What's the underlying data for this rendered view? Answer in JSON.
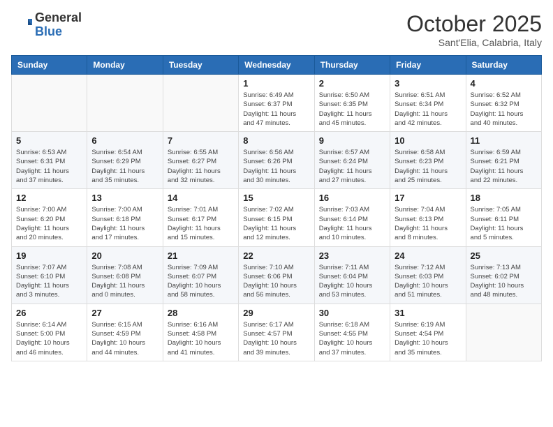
{
  "header": {
    "logo_general": "General",
    "logo_blue": "Blue",
    "month_title": "October 2025",
    "subtitle": "Sant'Elia, Calabria, Italy"
  },
  "days_of_week": [
    "Sunday",
    "Monday",
    "Tuesday",
    "Wednesday",
    "Thursday",
    "Friday",
    "Saturday"
  ],
  "weeks": [
    [
      {
        "day": "",
        "info": ""
      },
      {
        "day": "",
        "info": ""
      },
      {
        "day": "",
        "info": ""
      },
      {
        "day": "1",
        "info": "Sunrise: 6:49 AM\nSunset: 6:37 PM\nDaylight: 11 hours\nand 47 minutes."
      },
      {
        "day": "2",
        "info": "Sunrise: 6:50 AM\nSunset: 6:35 PM\nDaylight: 11 hours\nand 45 minutes."
      },
      {
        "day": "3",
        "info": "Sunrise: 6:51 AM\nSunset: 6:34 PM\nDaylight: 11 hours\nand 42 minutes."
      },
      {
        "day": "4",
        "info": "Sunrise: 6:52 AM\nSunset: 6:32 PM\nDaylight: 11 hours\nand 40 minutes."
      }
    ],
    [
      {
        "day": "5",
        "info": "Sunrise: 6:53 AM\nSunset: 6:31 PM\nDaylight: 11 hours\nand 37 minutes."
      },
      {
        "day": "6",
        "info": "Sunrise: 6:54 AM\nSunset: 6:29 PM\nDaylight: 11 hours\nand 35 minutes."
      },
      {
        "day": "7",
        "info": "Sunrise: 6:55 AM\nSunset: 6:27 PM\nDaylight: 11 hours\nand 32 minutes."
      },
      {
        "day": "8",
        "info": "Sunrise: 6:56 AM\nSunset: 6:26 PM\nDaylight: 11 hours\nand 30 minutes."
      },
      {
        "day": "9",
        "info": "Sunrise: 6:57 AM\nSunset: 6:24 PM\nDaylight: 11 hours\nand 27 minutes."
      },
      {
        "day": "10",
        "info": "Sunrise: 6:58 AM\nSunset: 6:23 PM\nDaylight: 11 hours\nand 25 minutes."
      },
      {
        "day": "11",
        "info": "Sunrise: 6:59 AM\nSunset: 6:21 PM\nDaylight: 11 hours\nand 22 minutes."
      }
    ],
    [
      {
        "day": "12",
        "info": "Sunrise: 7:00 AM\nSunset: 6:20 PM\nDaylight: 11 hours\nand 20 minutes."
      },
      {
        "day": "13",
        "info": "Sunrise: 7:00 AM\nSunset: 6:18 PM\nDaylight: 11 hours\nand 17 minutes."
      },
      {
        "day": "14",
        "info": "Sunrise: 7:01 AM\nSunset: 6:17 PM\nDaylight: 11 hours\nand 15 minutes."
      },
      {
        "day": "15",
        "info": "Sunrise: 7:02 AM\nSunset: 6:15 PM\nDaylight: 11 hours\nand 12 minutes."
      },
      {
        "day": "16",
        "info": "Sunrise: 7:03 AM\nSunset: 6:14 PM\nDaylight: 11 hours\nand 10 minutes."
      },
      {
        "day": "17",
        "info": "Sunrise: 7:04 AM\nSunset: 6:13 PM\nDaylight: 11 hours\nand 8 minutes."
      },
      {
        "day": "18",
        "info": "Sunrise: 7:05 AM\nSunset: 6:11 PM\nDaylight: 11 hours\nand 5 minutes."
      }
    ],
    [
      {
        "day": "19",
        "info": "Sunrise: 7:07 AM\nSunset: 6:10 PM\nDaylight: 11 hours\nand 3 minutes."
      },
      {
        "day": "20",
        "info": "Sunrise: 7:08 AM\nSunset: 6:08 PM\nDaylight: 11 hours\nand 0 minutes."
      },
      {
        "day": "21",
        "info": "Sunrise: 7:09 AM\nSunset: 6:07 PM\nDaylight: 10 hours\nand 58 minutes."
      },
      {
        "day": "22",
        "info": "Sunrise: 7:10 AM\nSunset: 6:06 PM\nDaylight: 10 hours\nand 56 minutes."
      },
      {
        "day": "23",
        "info": "Sunrise: 7:11 AM\nSunset: 6:04 PM\nDaylight: 10 hours\nand 53 minutes."
      },
      {
        "day": "24",
        "info": "Sunrise: 7:12 AM\nSunset: 6:03 PM\nDaylight: 10 hours\nand 51 minutes."
      },
      {
        "day": "25",
        "info": "Sunrise: 7:13 AM\nSunset: 6:02 PM\nDaylight: 10 hours\nand 48 minutes."
      }
    ],
    [
      {
        "day": "26",
        "info": "Sunrise: 6:14 AM\nSunset: 5:00 PM\nDaylight: 10 hours\nand 46 minutes."
      },
      {
        "day": "27",
        "info": "Sunrise: 6:15 AM\nSunset: 4:59 PM\nDaylight: 10 hours\nand 44 minutes."
      },
      {
        "day": "28",
        "info": "Sunrise: 6:16 AM\nSunset: 4:58 PM\nDaylight: 10 hours\nand 41 minutes."
      },
      {
        "day": "29",
        "info": "Sunrise: 6:17 AM\nSunset: 4:57 PM\nDaylight: 10 hours\nand 39 minutes."
      },
      {
        "day": "30",
        "info": "Sunrise: 6:18 AM\nSunset: 4:55 PM\nDaylight: 10 hours\nand 37 minutes."
      },
      {
        "day": "31",
        "info": "Sunrise: 6:19 AM\nSunset: 4:54 PM\nDaylight: 10 hours\nand 35 minutes."
      },
      {
        "day": "",
        "info": ""
      }
    ]
  ]
}
